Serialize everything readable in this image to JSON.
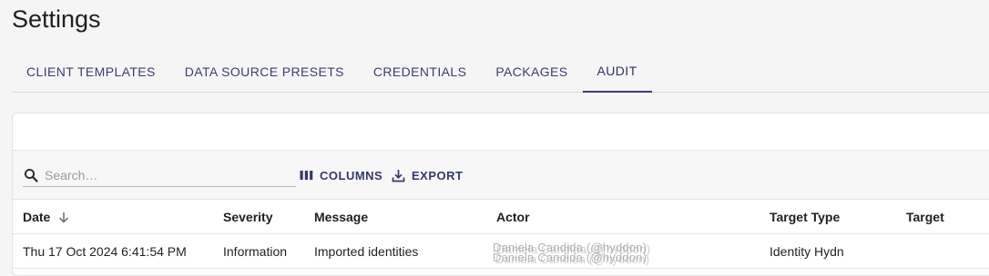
{
  "page": {
    "title": "Settings"
  },
  "tabs": [
    {
      "label": "CLIENT TEMPLATES",
      "active": false
    },
    {
      "label": "DATA SOURCE PRESETS",
      "active": false
    },
    {
      "label": "CREDENTIALS",
      "active": false
    },
    {
      "label": "PACKAGES",
      "active": false
    },
    {
      "label": "AUDIT",
      "active": true
    }
  ],
  "toolbar": {
    "search_placeholder": "Search…",
    "search_value": "",
    "columns_label": "COLUMNS",
    "export_label": "EXPORT"
  },
  "table": {
    "columns": [
      "Date",
      "Severity",
      "Message",
      "Actor",
      "Target Type",
      "Target"
    ],
    "sort": {
      "column": "Date",
      "direction": "descending",
      "icon": "arrow-down-icon"
    },
    "rows": [
      {
        "date": "Thu 17 Oct 2024 6:41:54 PM",
        "severity": "Information",
        "message": "Imported identities",
        "actor_line1": "Daniela Candida (@hyddon)",
        "actor_line2": "Daniela Candida (@hyddon)",
        "target_type": "Identity Hydn",
        "target": ""
      }
    ]
  },
  "colors": {
    "accent": "#3a3d7a",
    "tab_text": "#3b3f6b",
    "background": "#f5f5f5",
    "card": "#ffffff"
  },
  "icons": {
    "search": "search-icon",
    "columns": "columns-icon",
    "export": "export-icon",
    "sort": "arrow-down-icon"
  }
}
